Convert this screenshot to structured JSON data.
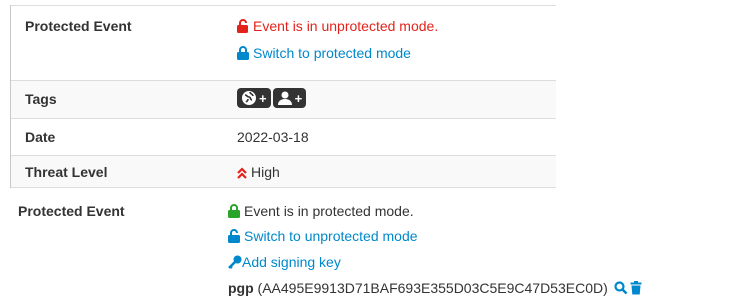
{
  "top": {
    "protected": {
      "label": "Protected Event",
      "status": "Event is in unprotected mode.",
      "action": "Switch to protected mode"
    },
    "tags": {
      "label": "Tags",
      "plus1": "+",
      "plus2": "+"
    },
    "date": {
      "label": "Date",
      "value": "2022-03-18"
    },
    "threat": {
      "label": "Threat Level",
      "value": "High"
    }
  },
  "bottom": {
    "label": "Protected Event",
    "status": "Event is in protected mode.",
    "switch": "Switch to unprotected mode",
    "add_key": "Add signing key",
    "pgp_label": "pgp",
    "pgp_fingerprint": "(AA495E9913D71BAF693E355D03C5E9C47D53EC0D)"
  },
  "colors": {
    "red": "#e3231b",
    "blue": "#0088cc",
    "green": "#29a329",
    "dark": "#333333"
  },
  "icons": [
    "lock-open-icon",
    "lock-icon",
    "globe-icon",
    "user-icon",
    "chevron-double-up-icon",
    "key-icon",
    "search-icon",
    "trash-icon"
  ]
}
